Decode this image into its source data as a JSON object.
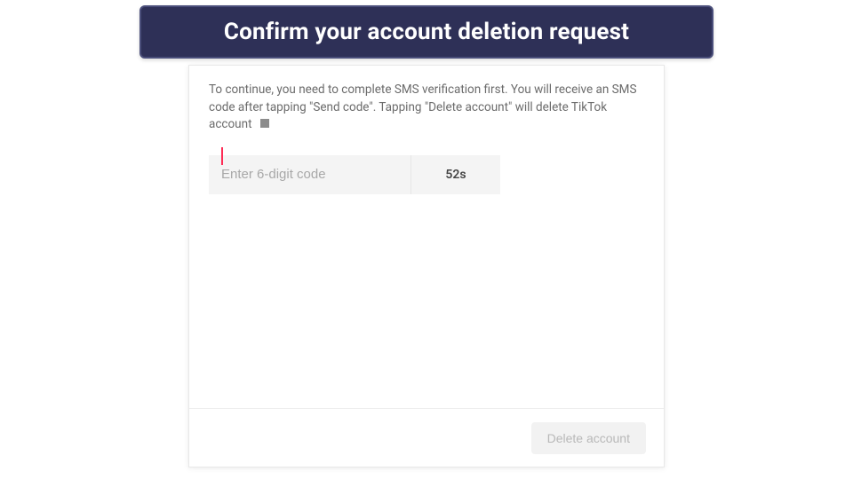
{
  "banner": {
    "title": "Confirm your account deletion request"
  },
  "card": {
    "instruction": "To continue, you need to complete SMS verification first. You will receive an SMS code after tapping \"Send code\". Tapping \"Delete account\" will delete TikTok account",
    "code_input": {
      "placeholder": "Enter 6-digit code",
      "value": ""
    },
    "countdown": "52s",
    "delete_button": "Delete account"
  }
}
